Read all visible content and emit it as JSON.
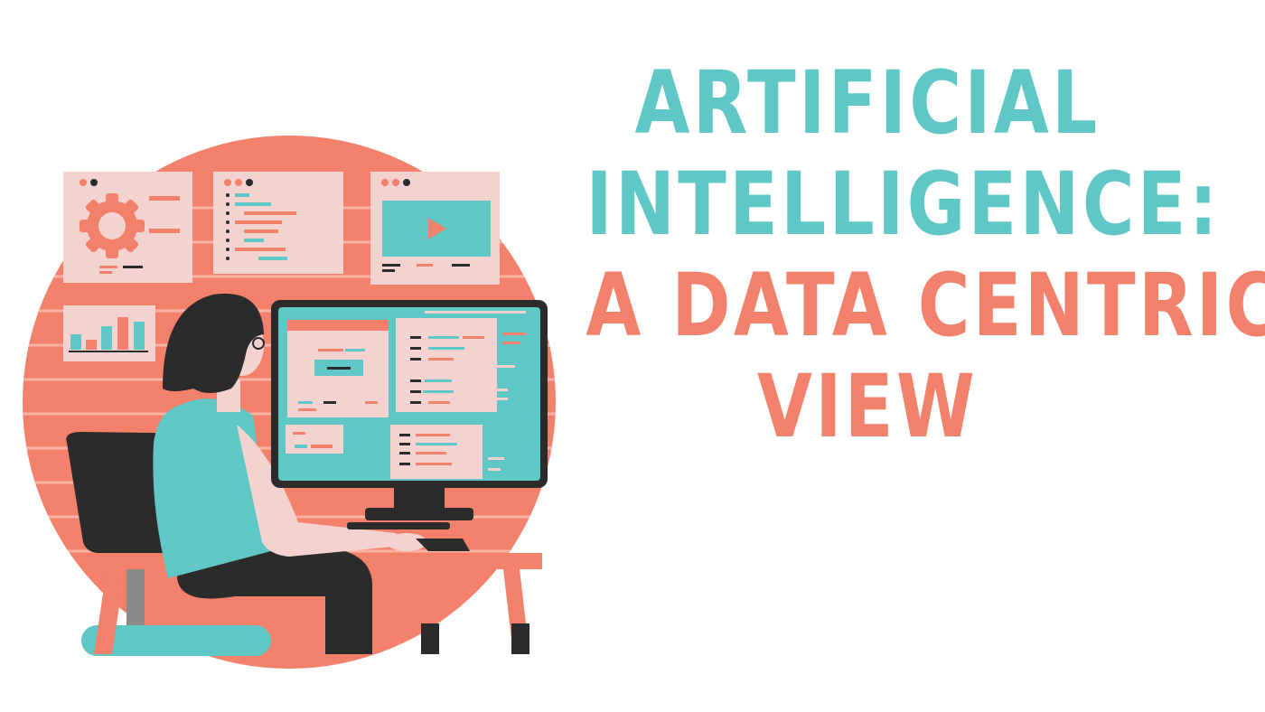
{
  "title": {
    "line1": "ARTIFICIAL",
    "line2": "INTELLIGENCE:",
    "line3": "A DATA CENTRIC",
    "line4": "VIEW"
  },
  "colors": {
    "teal": "#5fc7c5",
    "coral": "#f2806a",
    "pink": "#f4d2d0",
    "dark": "#2b2b2b",
    "background": "#ffffff"
  },
  "illustration": {
    "subject": "woman working at desktop computer",
    "icons": [
      "gear-icon",
      "code-lines-icon",
      "play-icon",
      "bar-chart-icon"
    ]
  }
}
